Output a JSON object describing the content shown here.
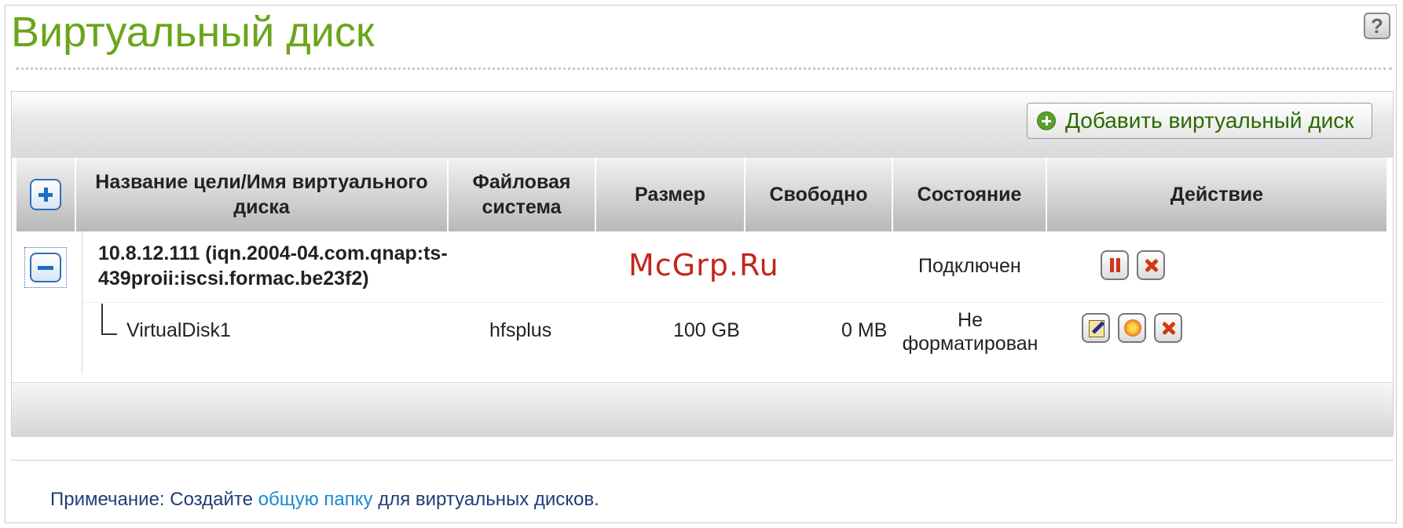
{
  "page": {
    "title": "Виртуальный диск",
    "help_label": "?"
  },
  "toolbar": {
    "add_button_label": "Добавить виртуальный диск"
  },
  "table": {
    "headers": [
      "Название цели/Имя виртуального диска",
      "Файловая система",
      "Размер",
      "Свободно",
      "Состояние",
      "Действие"
    ],
    "target": {
      "name": "10.8.12.111 (iqn.2004-04.com.qnap:ts-439proii:iscsi.formac.be23f2)",
      "status": "Подключен"
    },
    "disks": [
      {
        "name": "VirtualDisk1",
        "filesystem": "hfsplus",
        "size": "100 GB",
        "free": "0 MB",
        "status": "Не форматирован"
      }
    ]
  },
  "note": {
    "prefix": "Примечание: Создайте ",
    "link": "общую папку",
    "suffix": " для виртуальных дисков."
  },
  "watermark": "McGrp.Ru",
  "colors": {
    "title": "#6aa51c",
    "link": "#1a8ad4",
    "note_text": "#1e3e78",
    "watermark": "#c4241c"
  },
  "icons": [
    "help-icon",
    "add-circle-icon",
    "expand-all-icon",
    "collapse-icon",
    "pause-icon",
    "delete-icon",
    "edit-icon",
    "format-icon"
  ]
}
